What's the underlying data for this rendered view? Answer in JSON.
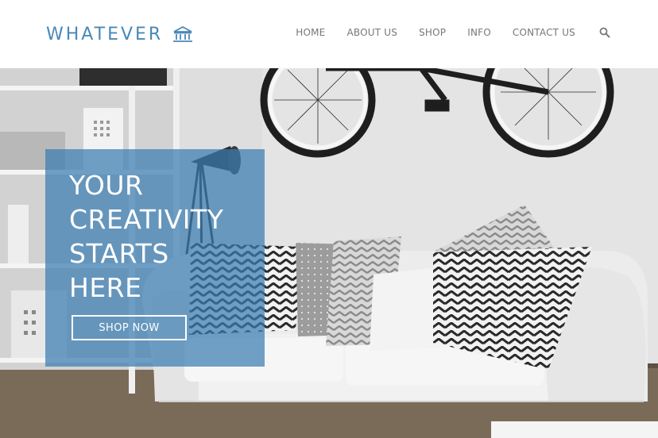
{
  "brand": {
    "name": "WHATEVER",
    "logo_icon": "bank-icon",
    "color": "#4a88b5"
  },
  "nav": {
    "items": [
      "HOME",
      "ABOUT US",
      "SHOP",
      "INFO",
      "CONTACT US"
    ],
    "search_icon": "search-icon",
    "text_color": "#777777"
  },
  "hero": {
    "headline_lines": [
      "YOUR",
      "CREATIVITY",
      "STARTS",
      "HERE"
    ],
    "cta_label": "SHOP NOW",
    "overlay_color": "#3a7db2",
    "photo": "living room with white sofa, chevron pillows and bicycle on wall"
  }
}
